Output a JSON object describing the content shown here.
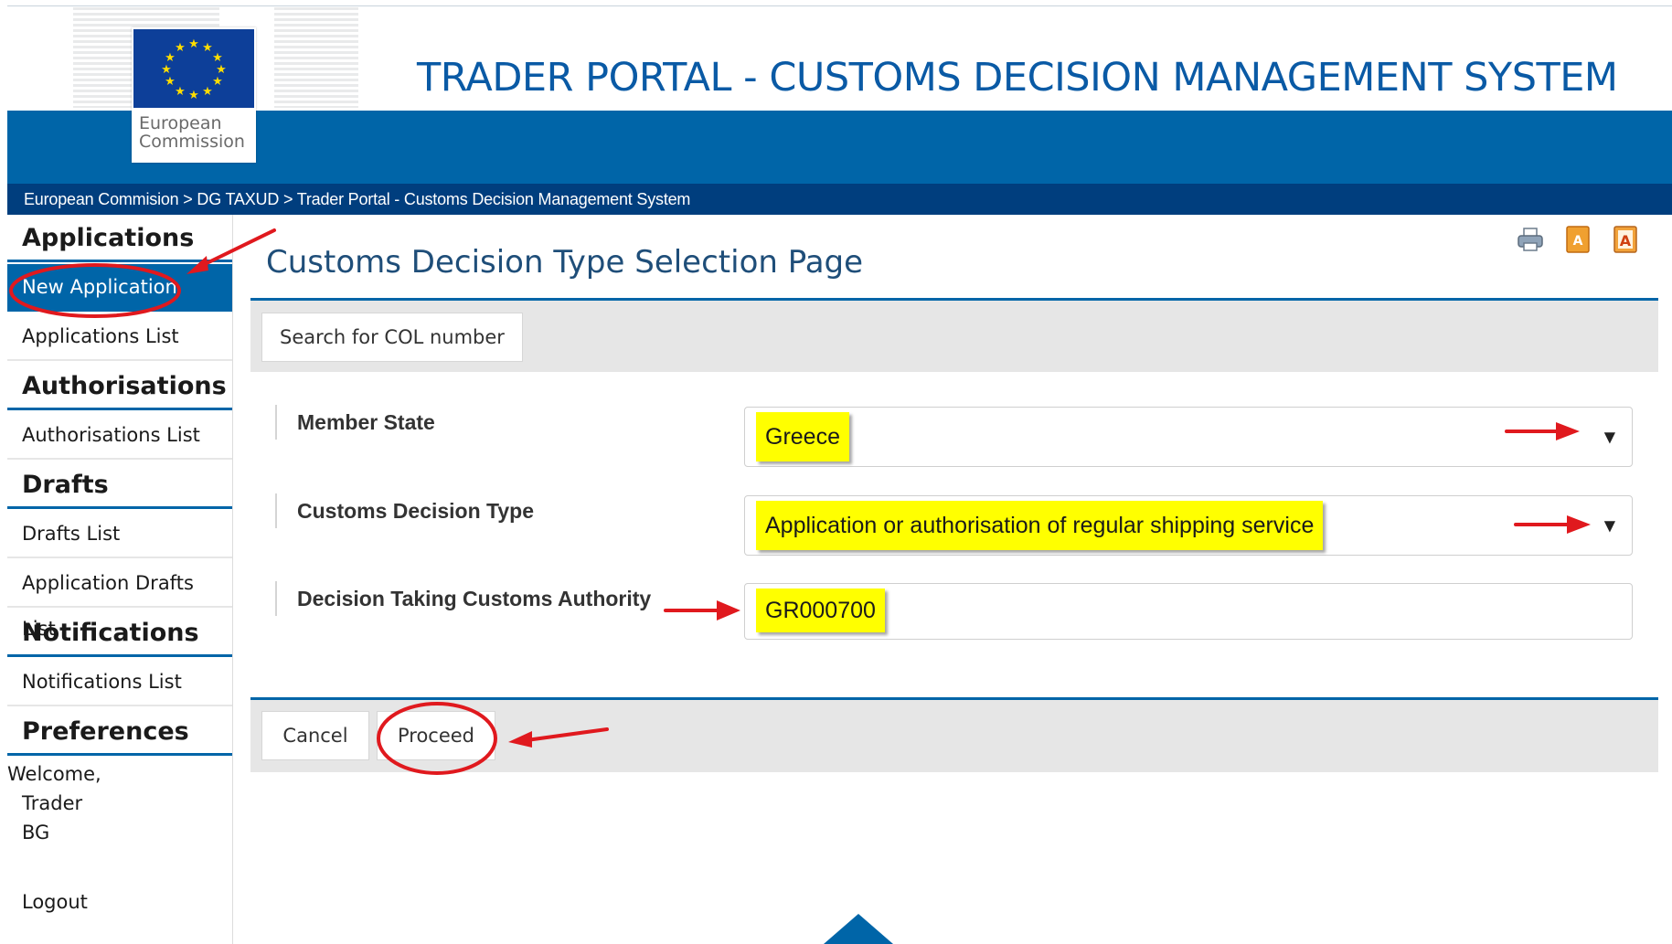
{
  "header": {
    "logo_text_line1": "European",
    "logo_text_line2": "Commission",
    "app_title": "TRADER PORTAL - CUSTOMS DECISION MANAGEMENT SYSTEM",
    "breadcrumb": "European Commision > DG TAXUD > Trader Portal - Customs Decision Management System"
  },
  "sidebar": {
    "sections": [
      {
        "heading": "Applications",
        "items": [
          "New Application",
          "Applications List"
        ]
      },
      {
        "heading": "Authorisations",
        "items": [
          "Authorisations List"
        ]
      },
      {
        "heading": "Drafts",
        "items": [
          "Drafts List",
          "Application Drafts List"
        ]
      },
      {
        "heading": "Notifications",
        "items": [
          "Notifications List"
        ]
      },
      {
        "heading": "Preferences",
        "items": []
      }
    ],
    "welcome_line1": "Welcome,",
    "welcome_line2": "Trader",
    "welcome_line3": "BG",
    "logout": "Logout"
  },
  "main": {
    "page_title": "Customs Decision Type Selection Page",
    "search_button": "Search for COL number",
    "fields": [
      {
        "label": "Member State",
        "value": "Greece",
        "type": "select"
      },
      {
        "label": "Customs Decision Type",
        "value": "Application or authorisation of regular shipping service",
        "type": "select"
      },
      {
        "label": "Decision Taking Customs Authority",
        "value": "GR000700",
        "type": "text"
      }
    ],
    "cancel_button": "Cancel",
    "proceed_button": "Proceed"
  },
  "toolbar_icons": [
    "print-icon",
    "pdf-icon",
    "acrobat-icon"
  ],
  "colors": {
    "primary_blue": "#0065a8",
    "dark_blue": "#003e7e",
    "title_blue": "#0a5aa5",
    "highlight": "#ffff00",
    "annotation_red": "#e0191e"
  }
}
